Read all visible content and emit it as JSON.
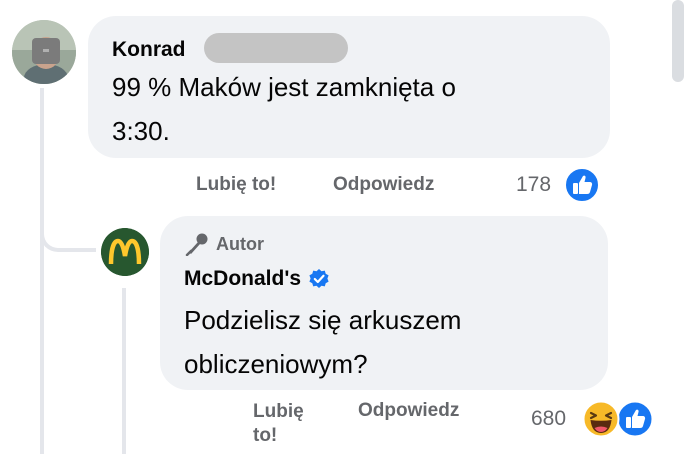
{
  "comment": {
    "author": "Konrad",
    "text_line1": "99 % Maków jest zamknięta o",
    "text_line2": "3:30.",
    "actions": {
      "like": "Lubię to!",
      "reply": "Odpowiedz"
    },
    "reaction_count": "178",
    "reactions": [
      "like-icon"
    ]
  },
  "reply": {
    "badge": "Autor",
    "author": "McDonald's",
    "verified": true,
    "text_line1": "Podzielisz się arkuszem",
    "text_line2": "obliczeniowym?",
    "actions": {
      "like_line1": "Lubię",
      "like_line2": "to!",
      "reply": "Odpowiedz"
    },
    "reaction_count": "680",
    "reactions": [
      "haha-icon",
      "like-icon"
    ]
  },
  "colors": {
    "bubble": "#f0f2f5",
    "secondary_text": "#65676b",
    "like_blue": "#1877f2",
    "mcd_green": "#27572f",
    "mcd_yellow": "#ffc72c"
  }
}
